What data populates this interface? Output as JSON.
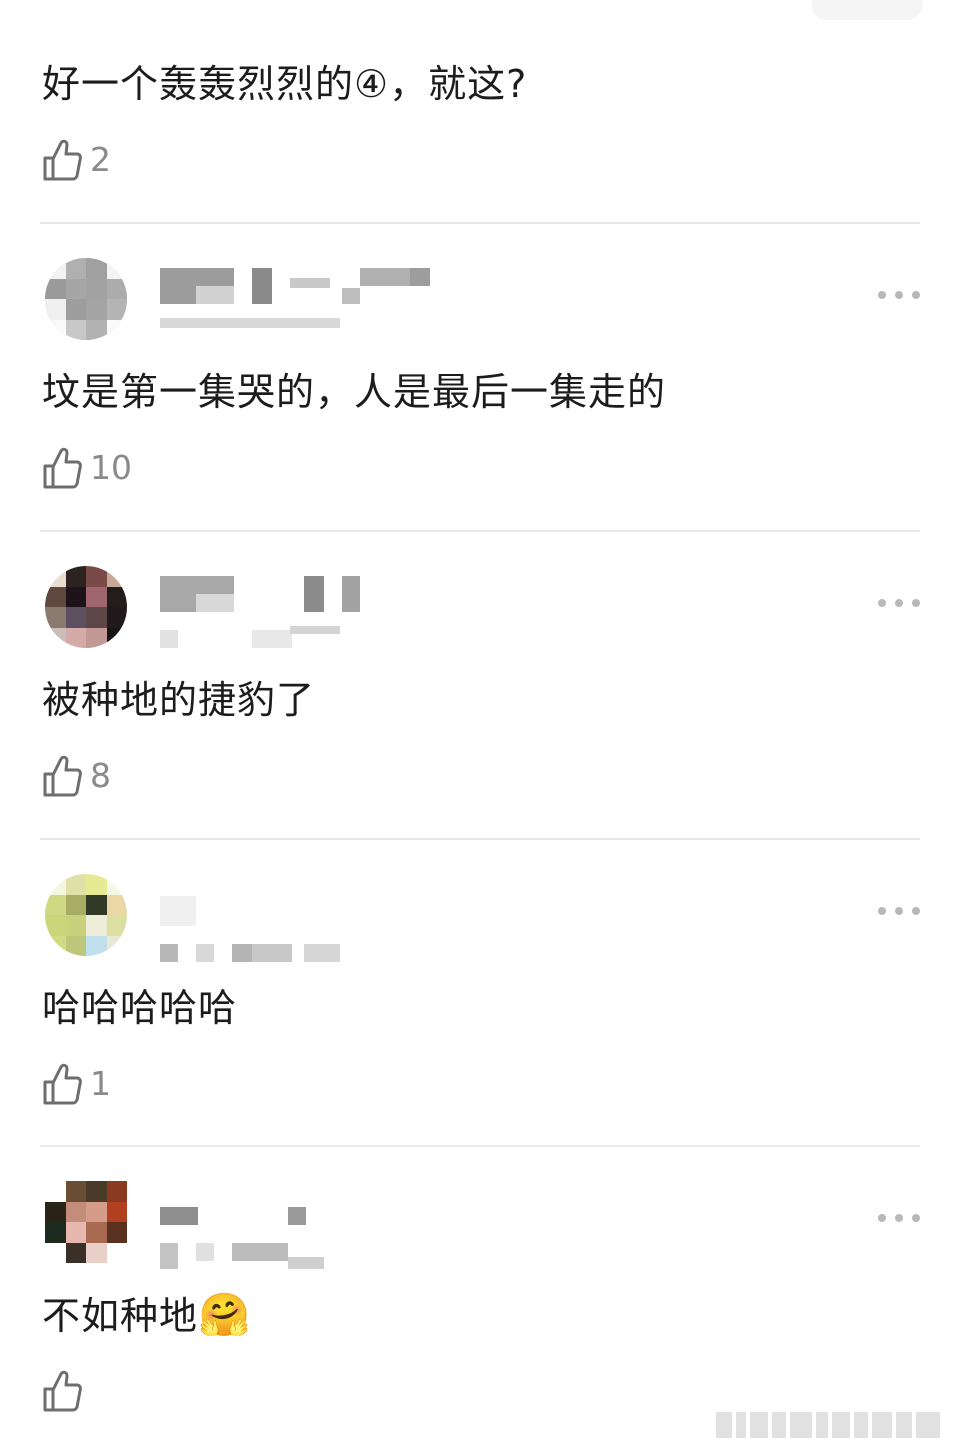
{
  "comments": [
    {
      "text": "好一个轰轰烈烈的④，就这?",
      "likes": "2",
      "has_header": false
    },
    {
      "text": "坟是第一集哭的，人是最后一集走的",
      "likes": "10",
      "has_header": true
    },
    {
      "text": "被种地的捷豹了",
      "likes": "8",
      "has_header": true
    },
    {
      "text": "哈哈哈哈哈",
      "likes": "1",
      "has_header": true
    },
    {
      "text": "不如种地",
      "emoji": "🤗",
      "likes": "",
      "has_header": true
    }
  ],
  "icons": {
    "like": "thumbs-up-icon",
    "more": "more-dots-icon"
  },
  "colors": {
    "text": "#1c1c1c",
    "meta": "#8a8a8a",
    "divider": "#e8e8e8",
    "dots": "#b8b8b8"
  }
}
